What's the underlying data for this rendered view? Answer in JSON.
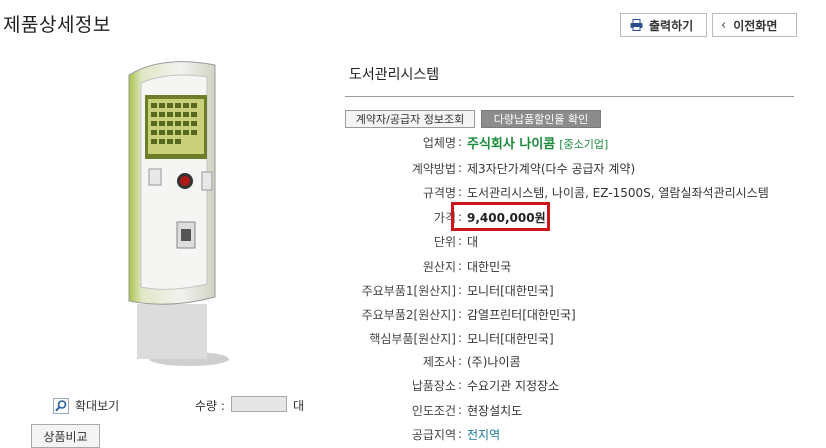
{
  "page": {
    "title": "제품상세정보"
  },
  "toolbar": {
    "print_label": "출력하기",
    "back_label": "이전화면"
  },
  "product": {
    "name": "도서관리시스템",
    "contract_info_button": "계약자/공급자 정보조회",
    "discount_button": "다량납품할인율 확인",
    "vendor_tag": "[중소기업]",
    "rows": [
      {
        "label": "업체명",
        "value": "주식회사 나이콤"
      },
      {
        "label": "계약방법",
        "value": "제3자단가계약(다수 공급자 계약)"
      },
      {
        "label": "규격명",
        "value": "도서관리시스템, 나이콤, EZ-1500S, 열람실좌석관리시스템"
      },
      {
        "label": "가격",
        "value": "9,400,000원"
      },
      {
        "label": "단위",
        "value": "대"
      },
      {
        "label": "원산지",
        "value": "대한민국"
      },
      {
        "label": "주요부품1[원산지]",
        "value": "모니터[대한민국]"
      },
      {
        "label": "주요부품2[원산지]",
        "value": "감열프린터[대한민국]"
      },
      {
        "label": "핵심부품[원산지]",
        "value": "모니터[대한민국]"
      },
      {
        "label": "제조사",
        "value": "(주)나이콤"
      },
      {
        "label": "납품장소",
        "value": "수요기관 지정장소"
      },
      {
        "label": "인도조건",
        "value": "현장설치도"
      },
      {
        "label": "공급지역",
        "value": "전지역"
      }
    ],
    "colors": {
      "vendor": "#1a8a3c",
      "price_highlight": "#d0141b",
      "link": "#1a7a9a"
    }
  },
  "image_panel": {
    "zoom_label": "확대보기",
    "quantity_label": "수량 :",
    "quantity_value": "",
    "quantity_unit": "대",
    "compare_button": "상품비교"
  }
}
